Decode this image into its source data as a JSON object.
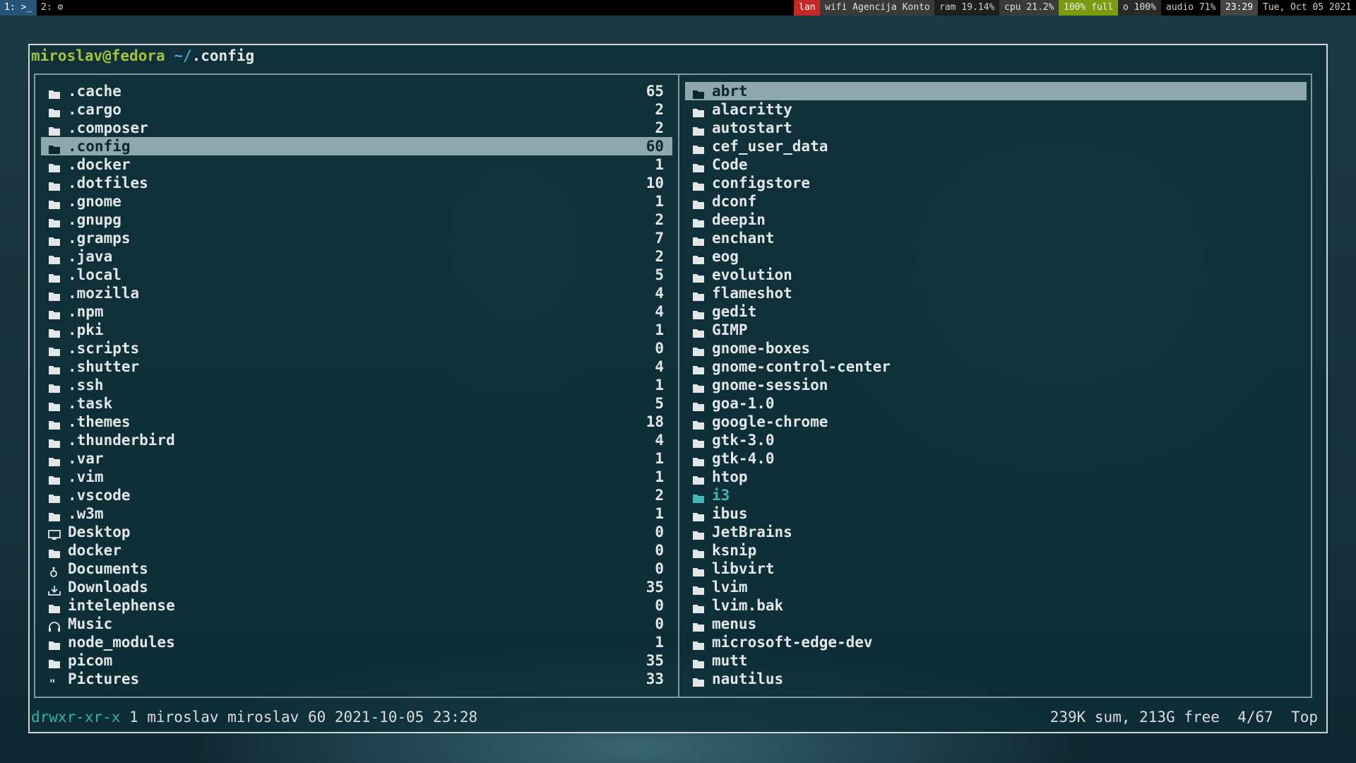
{
  "topbar": {
    "workspaces": [
      {
        "label": "1: >_"
      },
      {
        "label": "2: ⚙"
      }
    ],
    "status": [
      {
        "text": "lan",
        "bg": "#c62828",
        "fg": "#ffffff"
      },
      {
        "text": "wifi Agencija Konto",
        "bg": "#3a3a3a",
        "fg": "#e0e0e0"
      },
      {
        "text": "ram 19.14%",
        "bg": "#1f1f1f",
        "fg": "#d0d0d0"
      },
      {
        "text": "cpu 21.2%",
        "bg": "#3a3a3a",
        "fg": "#e0e0e0"
      },
      {
        "text": "100% full",
        "bg": "#7a9a10",
        "fg": "#f0f0f0"
      },
      {
        "text": "o 100%",
        "bg": "#2a2a2a",
        "fg": "#e0e0e0"
      },
      {
        "text": "audio 71%",
        "bg": "#000000",
        "fg": "#cfcfcf"
      },
      {
        "text": "23:29",
        "bg": "#444444",
        "fg": "#ffffff"
      },
      {
        "text": "Tue, Oct 05 2021",
        "bg": "#000000",
        "fg": "#d0d0d0"
      }
    ]
  },
  "prompt": {
    "user": "miroslav@fedora",
    "path": "~/",
    "name": ".config"
  },
  "left_pane": {
    "items": [
      {
        "name": ".cache",
        "count": "65",
        "icon": "folder-icon"
      },
      {
        "name": ".cargo",
        "count": "2",
        "icon": "folder-icon"
      },
      {
        "name": ".composer",
        "count": "2",
        "icon": "folder-icon"
      },
      {
        "name": ".config",
        "count": "60",
        "icon": "folder-icon",
        "selected": true
      },
      {
        "name": ".docker",
        "count": "1",
        "icon": "folder-icon"
      },
      {
        "name": ".dotfiles",
        "count": "10",
        "icon": "folder-icon"
      },
      {
        "name": ".gnome",
        "count": "1",
        "icon": "folder-icon"
      },
      {
        "name": ".gnupg",
        "count": "2",
        "icon": "folder-icon"
      },
      {
        "name": ".gramps",
        "count": "7",
        "icon": "folder-icon"
      },
      {
        "name": ".java",
        "count": "2",
        "icon": "folder-icon"
      },
      {
        "name": ".local",
        "count": "5",
        "icon": "folder-icon"
      },
      {
        "name": ".mozilla",
        "count": "4",
        "icon": "folder-icon"
      },
      {
        "name": ".npm",
        "count": "4",
        "icon": "folder-icon"
      },
      {
        "name": ".pki",
        "count": "1",
        "icon": "folder-icon"
      },
      {
        "name": ".scripts",
        "count": "0",
        "icon": "folder-icon"
      },
      {
        "name": ".shutter",
        "count": "4",
        "icon": "folder-icon"
      },
      {
        "name": ".ssh",
        "count": "1",
        "icon": "folder-icon"
      },
      {
        "name": ".task",
        "count": "5",
        "icon": "folder-icon"
      },
      {
        "name": ".themes",
        "count": "18",
        "icon": "folder-icon"
      },
      {
        "name": ".thunderbird",
        "count": "4",
        "icon": "folder-icon"
      },
      {
        "name": ".var",
        "count": "1",
        "icon": "folder-icon"
      },
      {
        "name": ".vim",
        "count": "1",
        "icon": "folder-icon"
      },
      {
        "name": ".vscode",
        "count": "2",
        "icon": "folder-icon"
      },
      {
        "name": ".w3m",
        "count": "1",
        "icon": "folder-icon"
      },
      {
        "name": "Desktop",
        "count": "0",
        "icon": "monitor-icon"
      },
      {
        "name": "docker",
        "count": "0",
        "icon": "folder-icon"
      },
      {
        "name": "Documents",
        "count": "0",
        "icon": "document-icon"
      },
      {
        "name": "Downloads",
        "count": "35",
        "icon": "download-icon"
      },
      {
        "name": "intelephense",
        "count": "0",
        "icon": "folder-icon"
      },
      {
        "name": "Music",
        "count": "0",
        "icon": "headphones-icon"
      },
      {
        "name": "node_modules",
        "count": "1",
        "icon": "folder-icon"
      },
      {
        "name": "picom",
        "count": "35",
        "icon": "folder-icon"
      },
      {
        "name": "Pictures",
        "count": "33",
        "icon": "quote-icon"
      }
    ]
  },
  "right_pane": {
    "items": [
      {
        "name": "abrt",
        "selected": true
      },
      {
        "name": "alacritty"
      },
      {
        "name": "autostart"
      },
      {
        "name": "cef_user_data"
      },
      {
        "name": "Code"
      },
      {
        "name": "configstore"
      },
      {
        "name": "dconf"
      },
      {
        "name": "deepin"
      },
      {
        "name": "enchant"
      },
      {
        "name": "eog"
      },
      {
        "name": "evolution"
      },
      {
        "name": "flameshot"
      },
      {
        "name": "gedit"
      },
      {
        "name": "GIMP"
      },
      {
        "name": "gnome-boxes"
      },
      {
        "name": "gnome-control-center"
      },
      {
        "name": "gnome-session"
      },
      {
        "name": "goa-1.0"
      },
      {
        "name": "google-chrome"
      },
      {
        "name": "gtk-3.0"
      },
      {
        "name": "gtk-4.0"
      },
      {
        "name": "htop"
      },
      {
        "name": "i3",
        "highlight": true
      },
      {
        "name": "ibus"
      },
      {
        "name": "JetBrains"
      },
      {
        "name": "ksnip"
      },
      {
        "name": "libvirt"
      },
      {
        "name": "lvim"
      },
      {
        "name": "lvim.bak"
      },
      {
        "name": "menus"
      },
      {
        "name": "microsoft-edge-dev"
      },
      {
        "name": "mutt"
      },
      {
        "name": "nautilus"
      }
    ]
  },
  "statusline": {
    "permissions": "drwxr-xr-x",
    "details": " 1 miroslav miroslav 60 2021-10-05 23:28",
    "summary": "239K sum, 213G free  4/67  Top"
  }
}
